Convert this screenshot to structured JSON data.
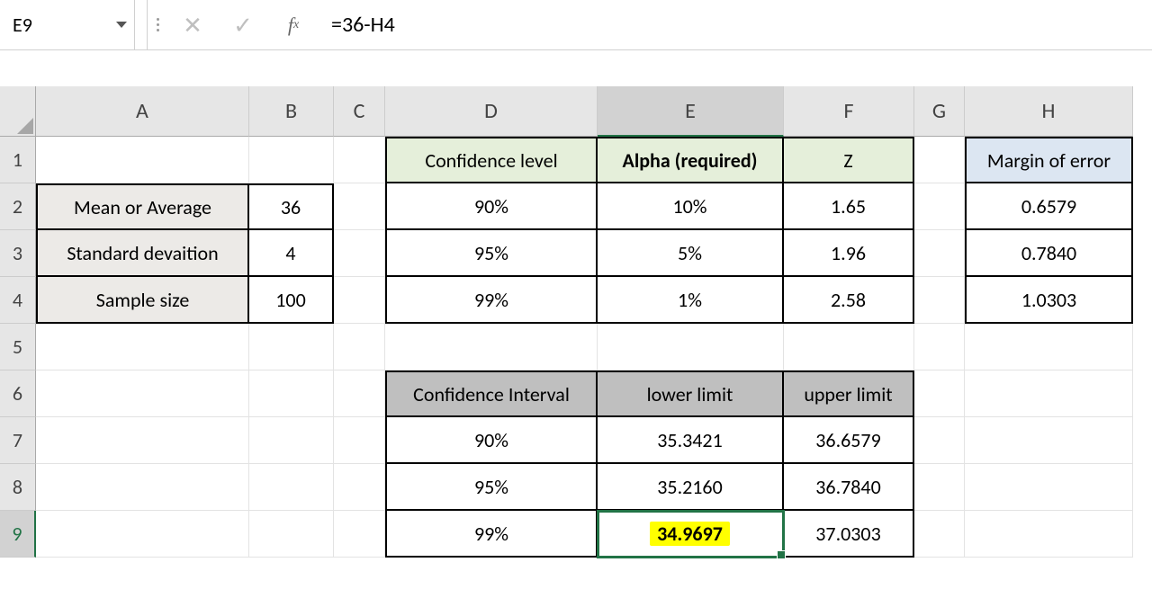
{
  "formula_bar": {
    "cell_ref": "E9",
    "formula": "=36-H4"
  },
  "columns": [
    "A",
    "B",
    "C",
    "D",
    "E",
    "F",
    "G",
    "H"
  ],
  "rows": [
    "1",
    "2",
    "3",
    "4",
    "5",
    "6",
    "7",
    "8",
    "9"
  ],
  "cells": {
    "A2": "Mean or Average",
    "A3": "Standard devaition",
    "A4": "Sample size",
    "B2": "36",
    "B3": "4",
    "B4": "100",
    "D1": "Confidence level",
    "E1": "Alpha (required)",
    "F1": "Z",
    "H1": "Margin of error",
    "D2": "90%",
    "E2": "10%",
    "F2": "1.65",
    "H2": "0.6579",
    "D3": "95%",
    "E3": "5%",
    "F3": "1.96",
    "H3": "0.7840",
    "D4": "99%",
    "E4": "1%",
    "F4": "2.58",
    "H4": "1.0303",
    "D6": "Confidence Interval",
    "E6": "lower limit",
    "F6": "upper limit",
    "D7": "90%",
    "E7": "35.3421",
    "F7": "36.6579",
    "D8": "95%",
    "E8": "35.2160",
    "F8": "36.7840",
    "D9": "99%",
    "E9": "34.9697",
    "F9": "37.0303"
  },
  "chart_data": {
    "type": "table",
    "title": "Confidence interval computation",
    "inputs": {
      "mean": 36,
      "std_dev": 4,
      "sample_size": 100
    },
    "levels": [
      {
        "confidence": 0.9,
        "alpha": 0.1,
        "z": 1.65,
        "margin_of_error": 0.6579,
        "lower": 35.3421,
        "upper": 36.6579
      },
      {
        "confidence": 0.95,
        "alpha": 0.05,
        "z": 1.96,
        "margin_of_error": 0.784,
        "lower": 35.216,
        "upper": 36.784
      },
      {
        "confidence": 0.99,
        "alpha": 0.01,
        "z": 2.58,
        "margin_of_error": 1.0303,
        "lower": 34.9697,
        "upper": 37.0303
      }
    ],
    "selected_cell": "E9",
    "selected_formula": "=36-H4"
  }
}
